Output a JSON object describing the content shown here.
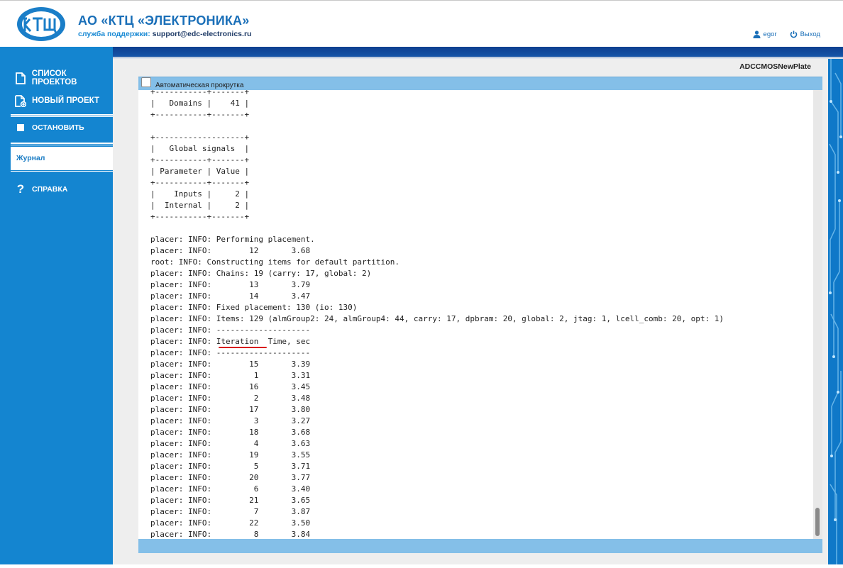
{
  "header": {
    "company": "АО «КТЦ «ЭЛЕКТРОНИКА»",
    "support_label": "служба поддержки:",
    "support_email": "support@edc-electronics.ru",
    "user": "egor",
    "logout": "Выход"
  },
  "sidebar": {
    "items": [
      {
        "label": "СПИСОК ПРОЕКТОВ",
        "icon": "document-icon"
      },
      {
        "label": "НОВЫЙ ПРОЕКТ",
        "icon": "new-document-icon"
      },
      {
        "label": "ОСТАНОВИТЬ",
        "icon": "stop-icon"
      },
      {
        "label": "Журнал",
        "icon": ""
      },
      {
        "label": "СПРАВКА",
        "icon": "question-icon"
      }
    ]
  },
  "main": {
    "project_name": "ADCCMOSNewPlate",
    "autoscroll_label": "Автоматическая прокрутка",
    "log_lines": [
      "+-----------+-------+",
      "|   Domains |    41 |",
      "+-----------+-------+",
      "",
      "+-------------------+",
      "|   Global signals  |",
      "+-----------+-------+",
      "| Parameter | Value |",
      "+-----------+-------+",
      "|    Inputs |     2 |",
      "|  Internal |     2 |",
      "+-----------+-------+",
      "",
      "placer: INFO: Performing placement.",
      "placer: INFO:        12       3.68",
      "root: INFO: Constructing items for default partition.",
      "placer: INFO: Chains: 19 (carry: 17, global: 2)",
      "placer: INFO:        13       3.79",
      "placer: INFO:        14       3.47",
      "placer: INFO: Fixed placement: 130 (io: 130)",
      "placer: INFO: Items: 129 (almGroup2: 24, almGroup4: 44, carry: 17, dpbram: 20, global: 2, jtag: 1, lcell_comb: 20, opt: 1)",
      "placer: INFO: --------------------",
      "placer: INFO: Iteration  Time, sec",
      "placer: INFO: --------------------",
      "placer: INFO:        15       3.39",
      "placer: INFO:         1       3.31",
      "placer: INFO:        16       3.45",
      "placer: INFO:         2       3.48",
      "placer: INFO:        17       3.80",
      "placer: INFO:         3       3.27",
      "placer: INFO:        18       3.68",
      "placer: INFO:         4       3.63",
      "placer: INFO:        19       3.55",
      "placer: INFO:         5       3.71",
      "placer: INFO:        20       3.77",
      "placer: INFO:         6       3.40",
      "placer: INFO:        21       3.65",
      "placer: INFO:         7       3.87",
      "placer: INFO:        22       3.50",
      "placer: INFO:         8       3.84"
    ]
  },
  "colors": {
    "sidebar": "#1485d0",
    "band": "#0d3f90",
    "panel_bar": "#84bfe8",
    "underline": "#d81b1b"
  }
}
